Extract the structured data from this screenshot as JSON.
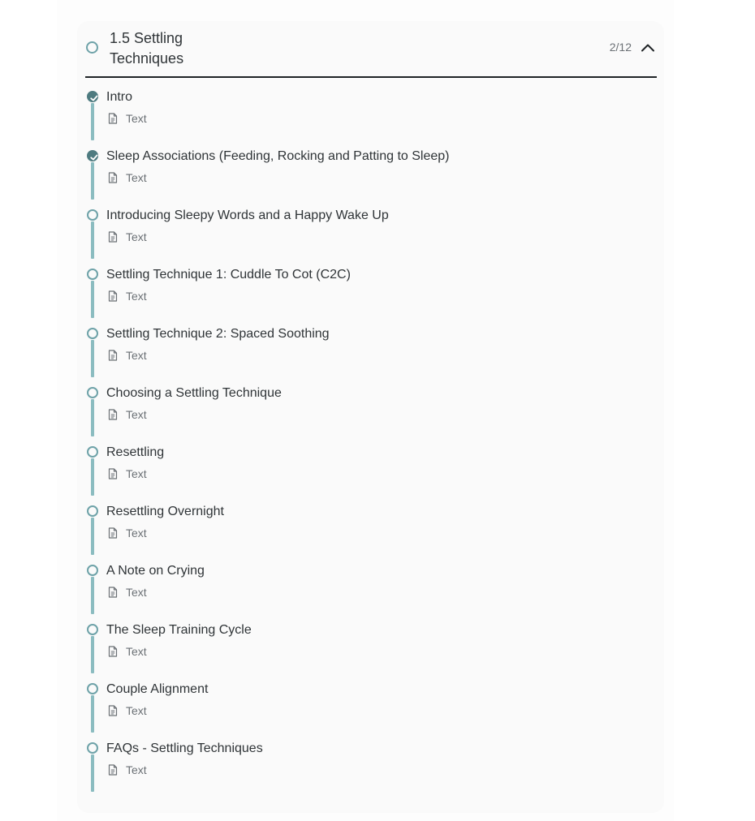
{
  "module": {
    "title": "1.5 Settling Techniques",
    "progress": "2/12",
    "expanded": true,
    "collapse_icon": "chevron-up-icon"
  },
  "lessons": [
    {
      "title": "Intro",
      "type": "Text",
      "completed": true
    },
    {
      "title": "Sleep Associations (Feeding, Rocking and Patting to Sleep)",
      "type": "Text",
      "completed": true
    },
    {
      "title": "Introducing Sleepy Words and a Happy Wake Up",
      "type": "Text",
      "completed": false
    },
    {
      "title": "Settling Technique 1: Cuddle To Cot (C2C)",
      "type": "Text",
      "completed": false
    },
    {
      "title": "Settling Technique 2: Spaced Soothing",
      "type": "Text",
      "completed": false
    },
    {
      "title": "Choosing a Settling Technique",
      "type": "Text",
      "completed": false
    },
    {
      "title": "Resettling",
      "type": "Text",
      "completed": false
    },
    {
      "title": "Resettling Overnight",
      "type": "Text",
      "completed": false
    },
    {
      "title": "A Note on Crying",
      "type": "Text",
      "completed": false
    },
    {
      "title": "The Sleep Training Cycle",
      "type": "Text",
      "completed": false
    },
    {
      "title": "Couple Alignment",
      "type": "Text",
      "completed": false
    },
    {
      "title": "FAQs - Settling Techniques",
      "type": "Text",
      "completed": false
    }
  ],
  "colors": {
    "accent": "#6ea2a8",
    "accent_dark": "#4e7b80",
    "rail": "#8bbcc0",
    "text": "#2f3437",
    "muted": "#6b7075"
  }
}
